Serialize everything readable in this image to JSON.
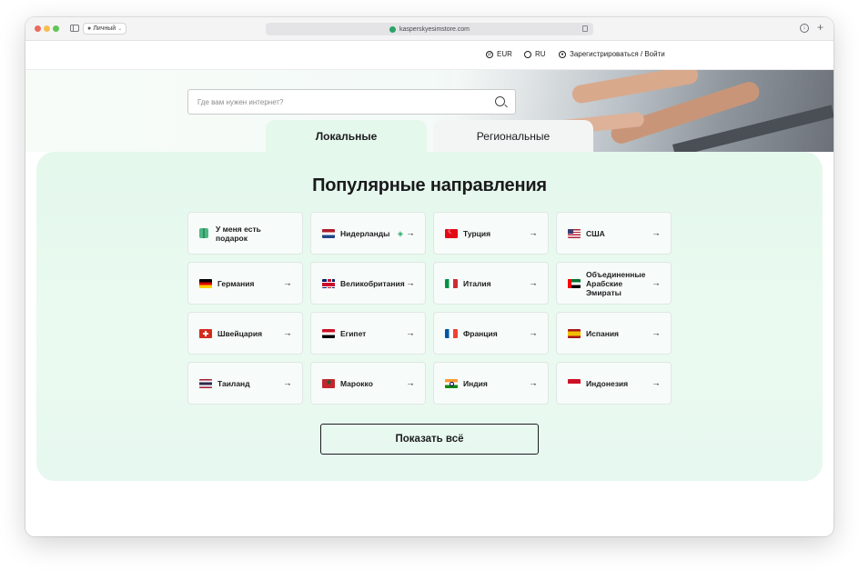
{
  "browser": {
    "profile_label": "Личный",
    "url": "kasperskyesimstore.com"
  },
  "header": {
    "currency": "EUR",
    "language": "RU",
    "auth": "Зарегистрироваться / Войти"
  },
  "hero": {
    "search_placeholder": "Где вам нужен интернет?",
    "tabs": [
      {
        "label": "Локальные",
        "active": true
      },
      {
        "label": "Региональные",
        "active": false
      }
    ]
  },
  "destinations": {
    "title": "Популярные направления",
    "items": [
      {
        "label": "У меня есть подарок",
        "icon": "gift-icon"
      },
      {
        "label": "Нидерланды",
        "icon": "flag-netherlands-icon",
        "badge": "esim-icon"
      },
      {
        "label": "Турция",
        "icon": "flag-turkey-icon"
      },
      {
        "label": "США",
        "icon": "flag-usa-icon"
      },
      {
        "label": "Германия",
        "icon": "flag-germany-icon"
      },
      {
        "label": "Великобритания",
        "icon": "flag-uk-icon"
      },
      {
        "label": "Италия",
        "icon": "flag-italy-icon"
      },
      {
        "label": "Объединенные Арабские Эмираты",
        "icon": "flag-uae-icon"
      },
      {
        "label": "Швейцария",
        "icon": "flag-switzerland-icon"
      },
      {
        "label": "Египет",
        "icon": "flag-egypt-icon"
      },
      {
        "label": "Франция",
        "icon": "flag-france-icon"
      },
      {
        "label": "Испания",
        "icon": "flag-spain-icon"
      },
      {
        "label": "Таиланд",
        "icon": "flag-thailand-icon"
      },
      {
        "label": "Марокко",
        "icon": "flag-morocco-icon"
      },
      {
        "label": "Индия",
        "icon": "flag-india-icon"
      },
      {
        "label": "Индонезия",
        "icon": "flag-indonesia-icon"
      }
    ],
    "show_all": "Показать всё"
  },
  "colors": {
    "panel_bg": "#e4f8ec",
    "accent_green": "#29a366",
    "text": "#1c1c1f"
  }
}
